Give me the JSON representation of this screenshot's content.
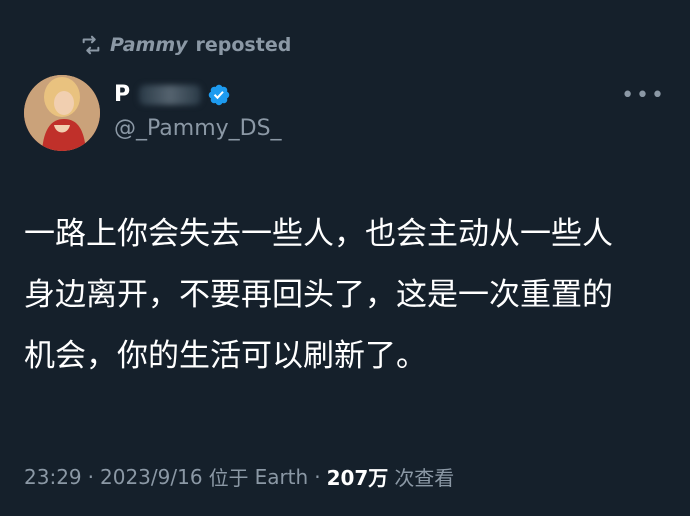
{
  "repost": {
    "user": "Pammy",
    "suffix": "reposted"
  },
  "author": {
    "display_name_visible": "P",
    "handle": "@_Pammy_DS_",
    "verified": true
  },
  "tweet": {
    "text": "一路上你会失去一些人，也会主动从一些人\n身边离开，不要再回头了，这是一次重置的\n机会，你的生活可以刷新了。"
  },
  "meta": {
    "time": "23:29",
    "sep1": "·",
    "date": "2023/9/16",
    "location_prefix": "位于",
    "location": "Earth",
    "sep2": "·",
    "views": "207万",
    "views_suffix": "次查看"
  },
  "colors": {
    "background": "#15202b",
    "muted": "#8b98a5",
    "verified_blue": "#1d9bf0"
  },
  "icons": {
    "repost": "repost-icon",
    "verified": "verified-badge-icon",
    "more": "more-icon"
  }
}
